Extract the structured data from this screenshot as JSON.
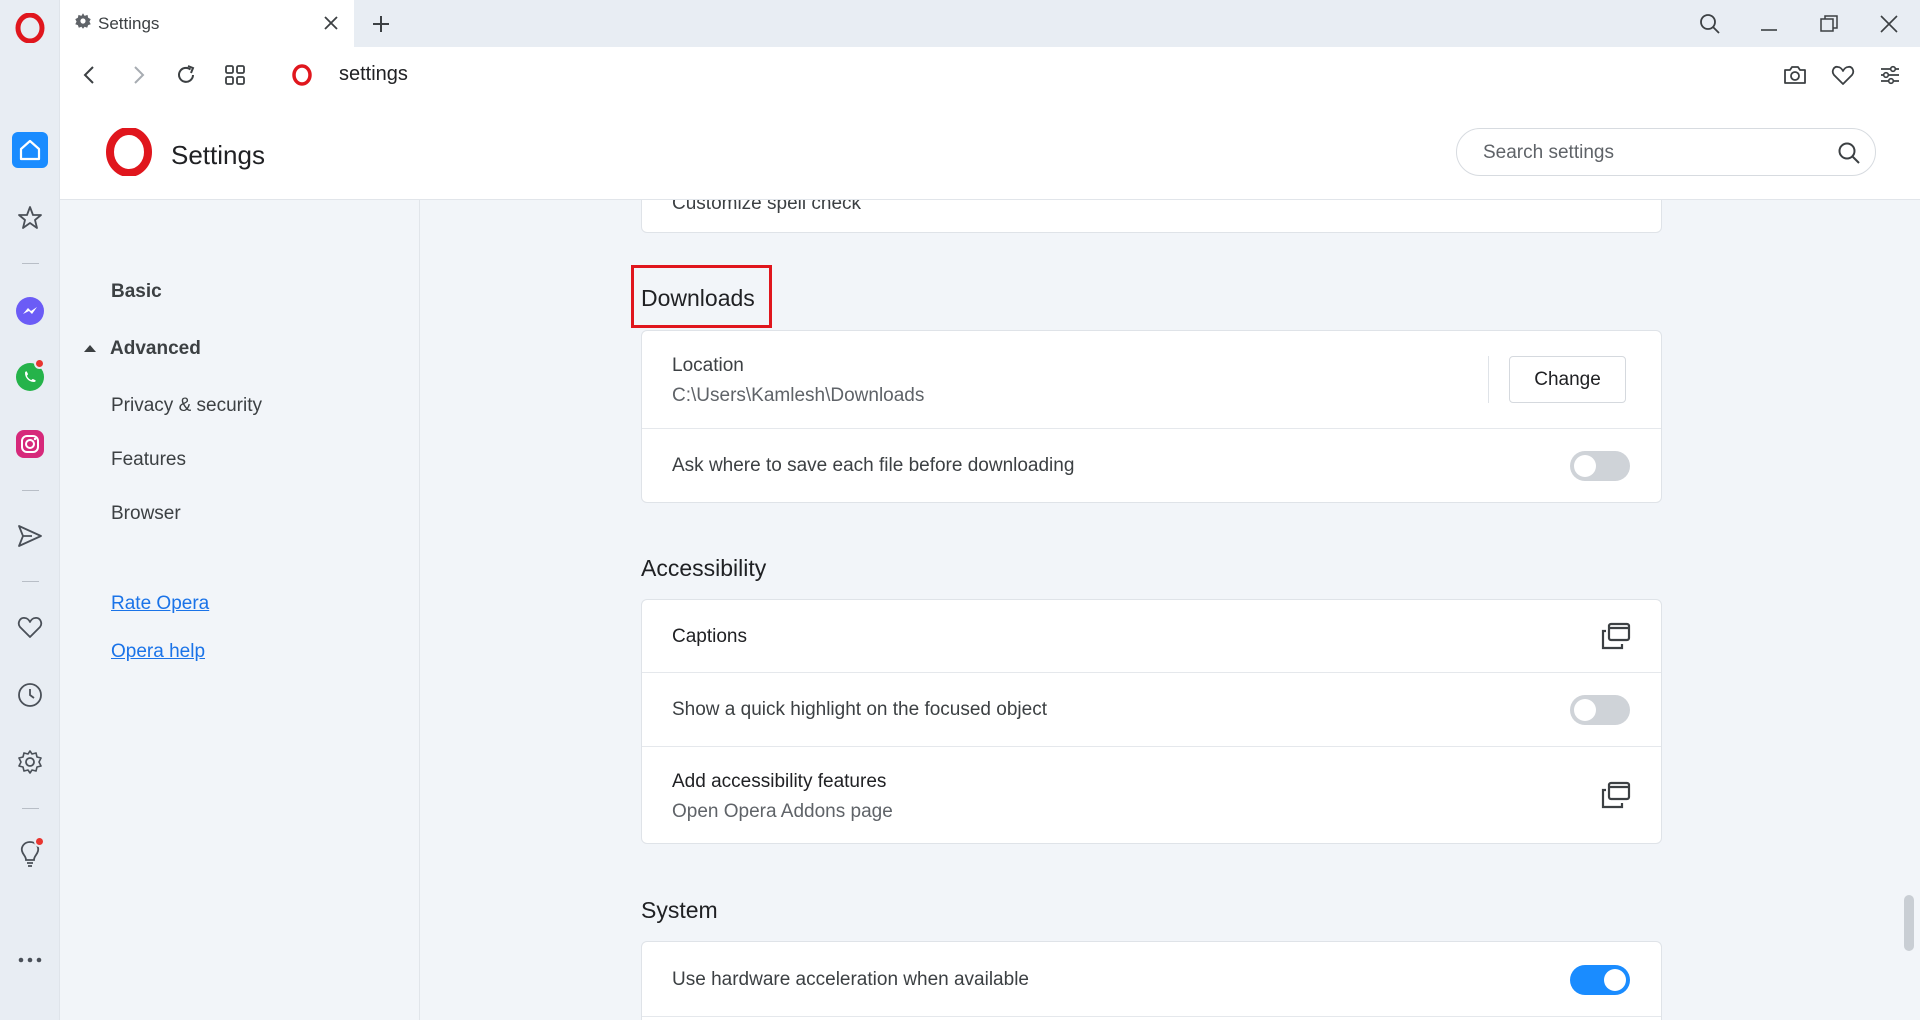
{
  "browser": {
    "tab": {
      "title": "Settings",
      "icon": "gear-icon"
    },
    "address": {
      "url": "settings"
    },
    "colors": {
      "opera_red": "#e0161d",
      "accent_blue": "#1a8cff",
      "highlight_box": "#e0161d"
    }
  },
  "sidebar": {
    "items": [
      {
        "name": "home-icon"
      },
      {
        "name": "speed-dial-star-icon"
      },
      {
        "name": "messenger-icon"
      },
      {
        "name": "whatsapp-icon"
      },
      {
        "name": "instagram-icon"
      },
      {
        "name": "send-icon"
      },
      {
        "name": "heart-icon"
      },
      {
        "name": "history-clock-icon"
      },
      {
        "name": "settings-gear-icon"
      },
      {
        "name": "lightbulb-icon"
      },
      {
        "name": "more-dots-icon"
      }
    ]
  },
  "header": {
    "title": "Settings",
    "search_placeholder": "Search settings"
  },
  "nav": {
    "basic": "Basic",
    "advanced": "Advanced",
    "privacy": "Privacy & security",
    "features": "Features",
    "browser": "Browser",
    "rate": "Rate Opera",
    "help": "Opera help"
  },
  "content": {
    "prev_row_label": "Customize spell check",
    "downloads": {
      "title": "Downloads",
      "location_label": "Location",
      "location_value": "C:\\Users\\Kamlesh\\Downloads",
      "change_button": "Change",
      "ask_label": "Ask where to save each file before downloading",
      "ask_enabled": false
    },
    "accessibility": {
      "title": "Accessibility",
      "captions_label": "Captions",
      "highlight_label": "Show a quick highlight on the focused object",
      "highlight_enabled": false,
      "addons_label": "Add accessibility features",
      "addons_sub": "Open Opera Addons page"
    },
    "system": {
      "title": "System",
      "hw_accel_label": "Use hardware acceleration when available",
      "hw_accel_enabled": true
    }
  }
}
